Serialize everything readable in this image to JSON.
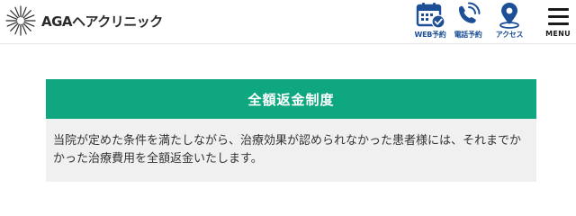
{
  "header": {
    "logo_text": "AGAヘアクリニック",
    "nav": [
      {
        "label": "WEB予約",
        "icon": "calendar-check-icon"
      },
      {
        "label": "電話予約",
        "icon": "phone-icon"
      },
      {
        "label": "アクセス",
        "icon": "map-pin-icon"
      }
    ],
    "menu_label": "MENU"
  },
  "guarantee": {
    "title": "全額返金制度",
    "body": "当院が定めた条件を満たしながら、治療効果が認められなかった患者様には、それまでかかった治療費用を全額返金いたします。"
  },
  "colors": {
    "accent_green": "#0fa77f",
    "nav_blue": "#1c4f96",
    "body_bg": "#f0f0f0"
  }
}
